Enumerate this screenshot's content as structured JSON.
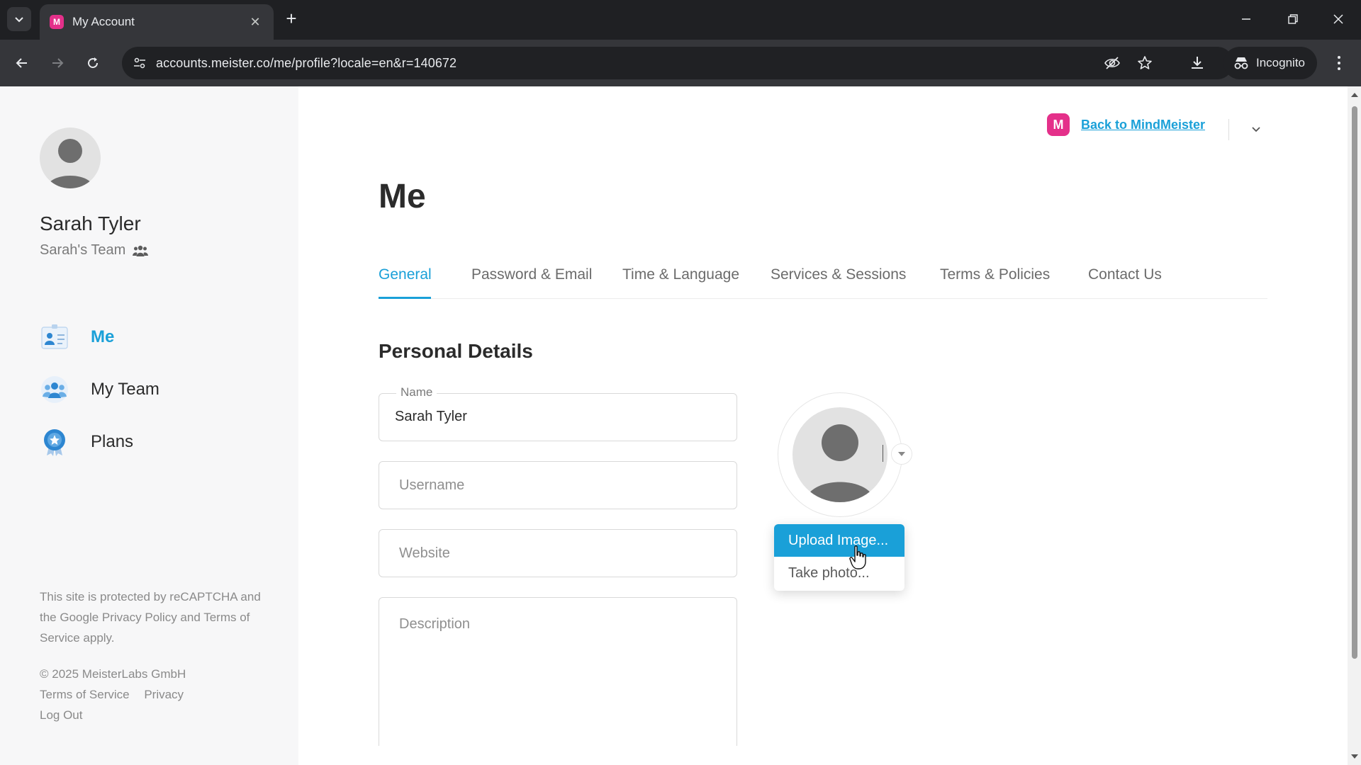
{
  "browser": {
    "tab_title": "My Account",
    "url": "accounts.meister.co/me/profile?locale=en&r=140672",
    "incognito_label": "Incognito"
  },
  "sidebar": {
    "user_name": "Sarah Tyler",
    "team_name": "Sarah's Team",
    "nav": [
      {
        "label": "Me",
        "icon": "profile-card-icon",
        "active": true
      },
      {
        "label": "My Team",
        "icon": "team-icon",
        "active": false
      },
      {
        "label": "Plans",
        "icon": "award-badge-icon",
        "active": false
      }
    ],
    "legal_text": "This site is protected by reCAPTCHA and the Google Privacy Policy and Terms of Service apply.",
    "copyright": "© 2025 MeisterLabs GmbH",
    "footer_links": [
      "Terms of Service",
      "Privacy"
    ],
    "logout": "Log Out"
  },
  "header": {
    "back_link": "Back to MindMeister",
    "logo_letter": "M"
  },
  "main": {
    "title": "Me",
    "tabs": [
      "General",
      "Password & Email",
      "Time & Language",
      "Services & Sessions",
      "Terms & Policies",
      "Contact Us"
    ],
    "active_tab": "General",
    "section_title": "Personal Details",
    "fields": {
      "name_label": "Name",
      "name_value": "Sarah Tyler",
      "username_placeholder": "Username",
      "website_placeholder": "Website",
      "description_placeholder": "Description"
    },
    "avatar_menu": {
      "upload": "Upload Image...",
      "take_photo": "Take photo..."
    }
  },
  "colors": {
    "accent": "#1aa0d8",
    "brand": "#e4308a",
    "sidebar_bg": "#f7f7f8"
  }
}
